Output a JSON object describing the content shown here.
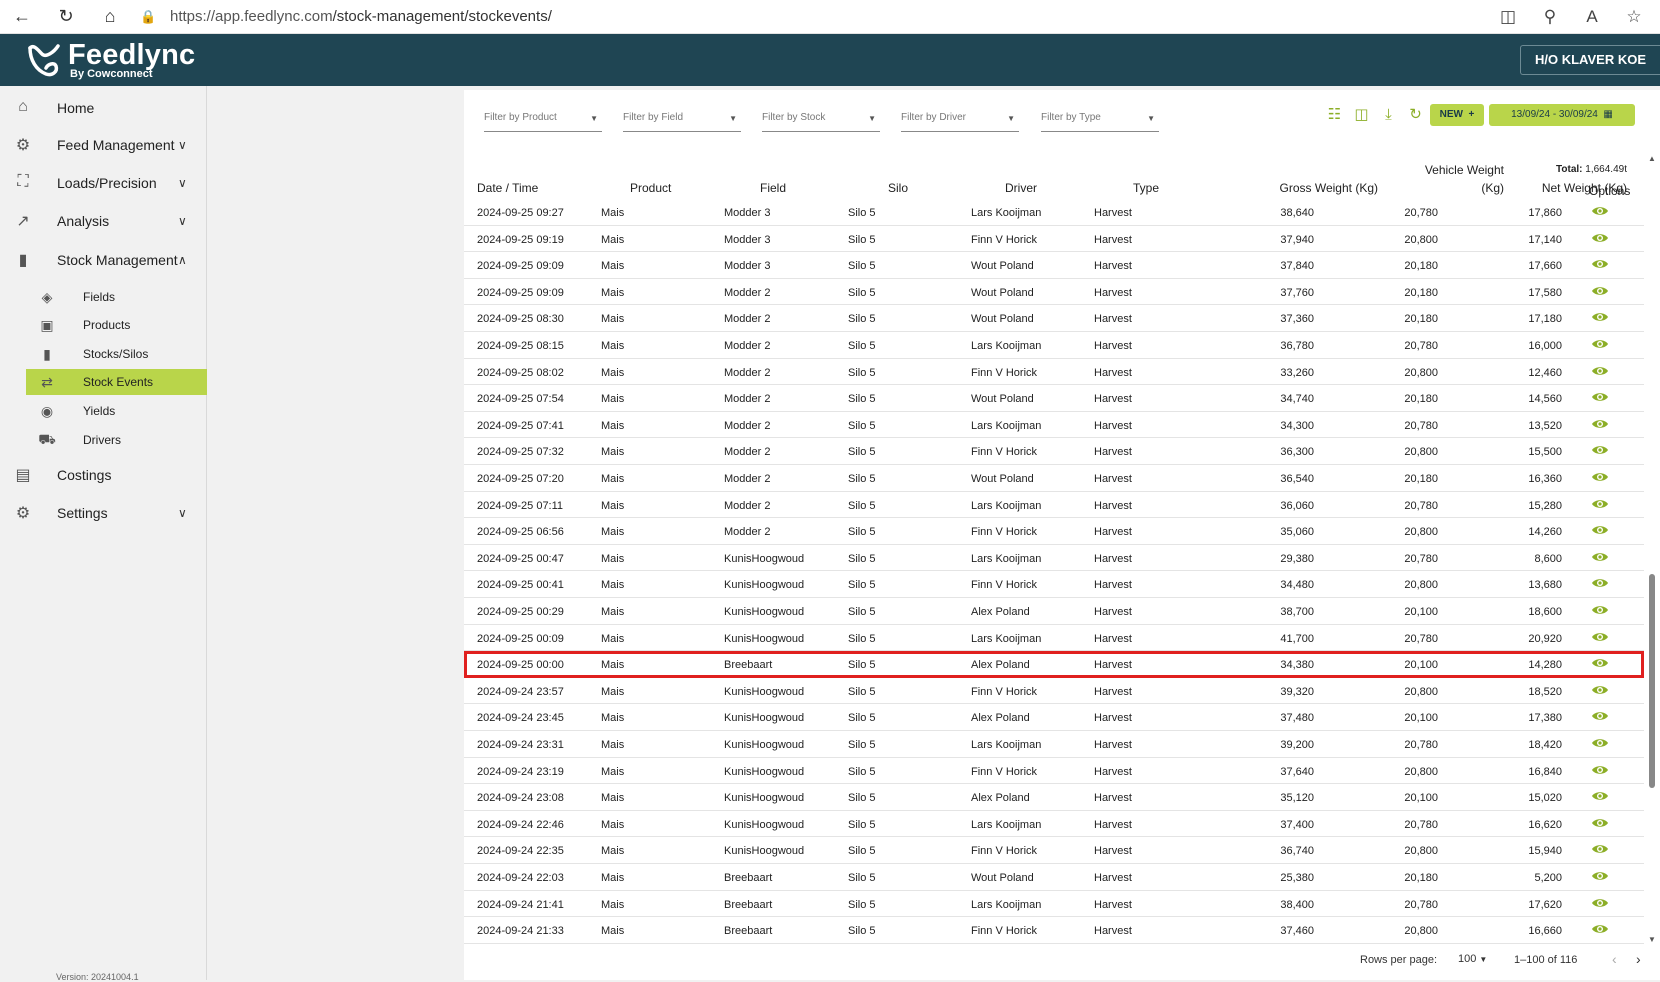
{
  "browser": {
    "url_host": "https://app.feedlync.com",
    "url_path": "/stock-management/stockevents/"
  },
  "app": {
    "brand": "Feedlync",
    "brand_sub": "By Cowconnect",
    "farm": "H/O KLAVER KOE"
  },
  "sidebar": {
    "items": [
      {
        "label": "Home"
      },
      {
        "label": "Feed Management"
      },
      {
        "label": "Loads/Precision"
      },
      {
        "label": "Analysis"
      },
      {
        "label": "Stock Management"
      },
      {
        "label": "Costings"
      },
      {
        "label": "Settings"
      }
    ],
    "sub_items": [
      {
        "label": "Fields"
      },
      {
        "label": "Products"
      },
      {
        "label": "Stocks/Silos"
      },
      {
        "label": "Stock Events"
      },
      {
        "label": "Yields"
      },
      {
        "label": "Drivers"
      }
    ],
    "version": "Version: 20241004.1"
  },
  "filters": {
    "product": "Filter by Product",
    "field": "Filter by Field",
    "stock": "Filter by Stock",
    "driver": "Filter by Driver",
    "type": "Filter by Type"
  },
  "toolbar": {
    "new_label": "NEW",
    "date_range": "13/09/24 - 30/09/24"
  },
  "table": {
    "headers": {
      "date": "Date / Time",
      "product": "Product",
      "field": "Field",
      "silo": "Silo",
      "driver": "Driver",
      "type": "Type",
      "gross": "Gross Weight (Kg)",
      "vehicle_1": "Vehicle Weight",
      "vehicle_2": "(Kg)",
      "total_label": "Total:",
      "total_value": "1,664.49t",
      "net": "Net Weight (Kg)",
      "options": "Options"
    },
    "highlight_row_index": 17,
    "rows": [
      [
        "2024-09-25 09:27",
        "Mais",
        "Modder 3",
        "Silo 5",
        "Lars Kooijman",
        "Harvest",
        "38,640",
        "20,780",
        "17,860"
      ],
      [
        "2024-09-25 09:19",
        "Mais",
        "Modder 3",
        "Silo 5",
        "Finn V Horick",
        "Harvest",
        "37,940",
        "20,800",
        "17,140"
      ],
      [
        "2024-09-25 09:09",
        "Mais",
        "Modder 3",
        "Silo 5",
        "Wout Poland",
        "Harvest",
        "37,840",
        "20,180",
        "17,660"
      ],
      [
        "2024-09-25 09:09",
        "Mais",
        "Modder 2",
        "Silo 5",
        "Wout Poland",
        "Harvest",
        "37,760",
        "20,180",
        "17,580"
      ],
      [
        "2024-09-25 08:30",
        "Mais",
        "Modder 2",
        "Silo 5",
        "Wout Poland",
        "Harvest",
        "37,360",
        "20,180",
        "17,180"
      ],
      [
        "2024-09-25 08:15",
        "Mais",
        "Modder 2",
        "Silo 5",
        "Lars Kooijman",
        "Harvest",
        "36,780",
        "20,780",
        "16,000"
      ],
      [
        "2024-09-25 08:02",
        "Mais",
        "Modder 2",
        "Silo 5",
        "Finn V Horick",
        "Harvest",
        "33,260",
        "20,800",
        "12,460"
      ],
      [
        "2024-09-25 07:54",
        "Mais",
        "Modder 2",
        "Silo 5",
        "Wout Poland",
        "Harvest",
        "34,740",
        "20,180",
        "14,560"
      ],
      [
        "2024-09-25 07:41",
        "Mais",
        "Modder 2",
        "Silo 5",
        "Lars Kooijman",
        "Harvest",
        "34,300",
        "20,780",
        "13,520"
      ],
      [
        "2024-09-25 07:32",
        "Mais",
        "Modder 2",
        "Silo 5",
        "Finn V Horick",
        "Harvest",
        "36,300",
        "20,800",
        "15,500"
      ],
      [
        "2024-09-25 07:20",
        "Mais",
        "Modder 2",
        "Silo 5",
        "Wout Poland",
        "Harvest",
        "36,540",
        "20,180",
        "16,360"
      ],
      [
        "2024-09-25 07:11",
        "Mais",
        "Modder 2",
        "Silo 5",
        "Lars Kooijman",
        "Harvest",
        "36,060",
        "20,780",
        "15,280"
      ],
      [
        "2024-09-25 06:56",
        "Mais",
        "Modder 2",
        "Silo 5",
        "Finn V Horick",
        "Harvest",
        "35,060",
        "20,800",
        "14,260"
      ],
      [
        "2024-09-25 00:47",
        "Mais",
        "KunisHoogwoud",
        "Silo 5",
        "Lars Kooijman",
        "Harvest",
        "29,380",
        "20,780",
        "8,600"
      ],
      [
        "2024-09-25 00:41",
        "Mais",
        "KunisHoogwoud",
        "Silo 5",
        "Finn V Horick",
        "Harvest",
        "34,480",
        "20,800",
        "13,680"
      ],
      [
        "2024-09-25 00:29",
        "Mais",
        "KunisHoogwoud",
        "Silo 5",
        "Alex Poland",
        "Harvest",
        "38,700",
        "20,100",
        "18,600"
      ],
      [
        "2024-09-25 00:09",
        "Mais",
        "KunisHoogwoud",
        "Silo 5",
        "Lars Kooijman",
        "Harvest",
        "41,700",
        "20,780",
        "20,920"
      ],
      [
        "2024-09-25 00:00",
        "Mais",
        "Breebaart",
        "Silo 5",
        "Alex Poland",
        "Harvest",
        "34,380",
        "20,100",
        "14,280"
      ],
      [
        "2024-09-24 23:57",
        "Mais",
        "KunisHoogwoud",
        "Silo 5",
        "Finn V Horick",
        "Harvest",
        "39,320",
        "20,800",
        "18,520"
      ],
      [
        "2024-09-24 23:45",
        "Mais",
        "KunisHoogwoud",
        "Silo 5",
        "Alex Poland",
        "Harvest",
        "37,480",
        "20,100",
        "17,380"
      ],
      [
        "2024-09-24 23:31",
        "Mais",
        "KunisHoogwoud",
        "Silo 5",
        "Lars Kooijman",
        "Harvest",
        "39,200",
        "20,780",
        "18,420"
      ],
      [
        "2024-09-24 23:19",
        "Mais",
        "KunisHoogwoud",
        "Silo 5",
        "Finn V Horick",
        "Harvest",
        "37,640",
        "20,800",
        "16,840"
      ],
      [
        "2024-09-24 23:08",
        "Mais",
        "KunisHoogwoud",
        "Silo 5",
        "Alex Poland",
        "Harvest",
        "35,120",
        "20,100",
        "15,020"
      ],
      [
        "2024-09-24 22:46",
        "Mais",
        "KunisHoogwoud",
        "Silo 5",
        "Lars Kooijman",
        "Harvest",
        "37,400",
        "20,780",
        "16,620"
      ],
      [
        "2024-09-24 22:35",
        "Mais",
        "KunisHoogwoud",
        "Silo 5",
        "Finn V Horick",
        "Harvest",
        "36,740",
        "20,800",
        "15,940"
      ],
      [
        "2024-09-24 22:03",
        "Mais",
        "Breebaart",
        "Silo 5",
        "Wout Poland",
        "Harvest",
        "25,380",
        "20,180",
        "5,200"
      ],
      [
        "2024-09-24 21:41",
        "Mais",
        "Breebaart",
        "Silo 5",
        "Lars Kooijman",
        "Harvest",
        "38,400",
        "20,780",
        "17,620"
      ],
      [
        "2024-09-24 21:33",
        "Mais",
        "Breebaart",
        "Silo 5",
        "Finn V Horick",
        "Harvest",
        "37,460",
        "20,800",
        "16,660"
      ]
    ]
  },
  "pagination": {
    "rows_per_page_label": "Rows per page:",
    "rows_per_page": "100",
    "range": "1–100 of 116"
  },
  "colors": {
    "header_bg": "#1f4553",
    "accent": "#b9d54a",
    "icon_green": "#8cae27",
    "highlight": "#e0201f"
  }
}
